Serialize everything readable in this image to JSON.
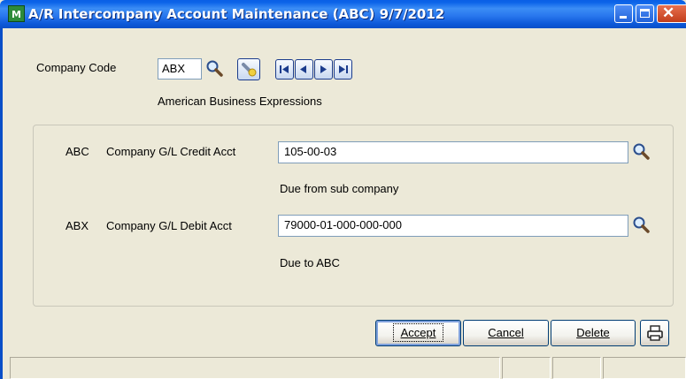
{
  "window": {
    "icon_text": "M",
    "title": "A/R Intercompany Account Maintenance (ABC) 9/7/2012"
  },
  "company": {
    "label": "Company Code",
    "value": "ABX",
    "name": "American Business Expressions"
  },
  "credit": {
    "code": "ABC",
    "label": "Company G/L Credit Acct",
    "value": "105-00-03",
    "description": "Due from sub company"
  },
  "debit": {
    "code": "ABX",
    "label": "Company G/L Debit Acct",
    "value": "79000-01-000-000-000",
    "description": "Due to ABC"
  },
  "buttons": {
    "accept": "Accept",
    "cancel": "Cancel",
    "delete": "Delete"
  },
  "icons": {
    "lookup": "magnifier-icon",
    "note": "pencil-note-icon",
    "print": "printer-icon"
  }
}
